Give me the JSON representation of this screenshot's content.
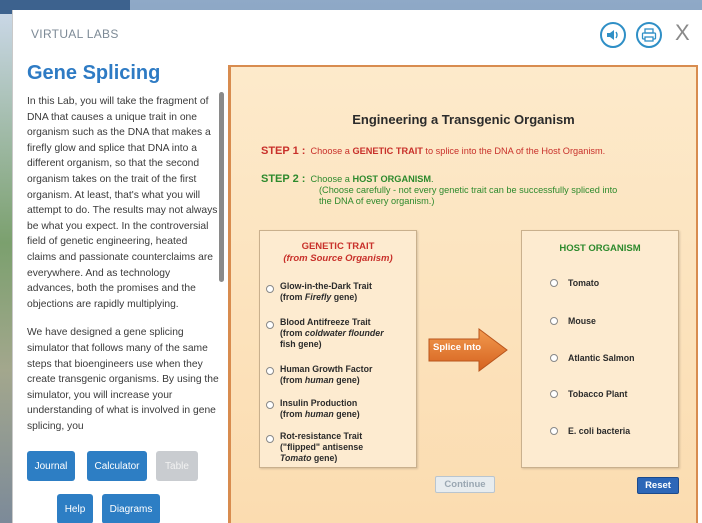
{
  "window": {
    "app_title": "VIRTUAL LABS",
    "close_glyph": "X"
  },
  "toolbar": {
    "icons": [
      "audio-icon",
      "print-icon",
      "close-icon"
    ]
  },
  "lesson": {
    "title": "Gene Splicing",
    "paragraphs": [
      "In this Lab, you will take the fragment of DNA that causes a unique trait in one organism such as the DNA that makes a firefly glow and splice that DNA into a different organism, so that the second organism takes on the trait of the first organism. At least, that's what you will attempt to do. The results may not always be what you expect. In the controversial field of genetic engineering, heated claims and passionate counterclaims are everywhere. And as technology advances, both the promises and the objections are rapidly multiplying.",
      "We have designed a gene splicing simulator that follows many of the same steps that bioengineers use when they create transgenic organisms. By using the simulator, you will increase your understanding of what is involved in gene splicing, you"
    ]
  },
  "tools": {
    "journal": "Journal",
    "calculator": "Calculator",
    "table": "Table",
    "help": "Help",
    "diagrams": "Diagrams"
  },
  "simulator": {
    "title": "Engineering a Transgenic Organism",
    "step1": {
      "label": "STEP 1 :",
      "pre": "Choose a ",
      "key": "GENETIC TRAIT",
      "post": " to splice into the DNA of the Host Organism."
    },
    "step2": {
      "label": "STEP 2 :",
      "pre": "Choose a ",
      "key": "HOST ORGANISM",
      "post": ".",
      "note_line1": "(Choose carefully - not every genetic trait can be successfully spliced into",
      "note_line2": "the DNA of every organism.)"
    },
    "genetic_panel": {
      "title": "GENETIC TRAIT",
      "subtitle": "(from Source Organism)",
      "options": [
        {
          "line1": "Glow-in-the-Dark Trait",
          "line2_pre": "(from ",
          "line2_em": "Firefly",
          "line2_post": " gene)",
          "line3": ""
        },
        {
          "line1": "Blood Antifreeze Trait",
          "line2_pre": "(from ",
          "line2_em": "coldwater flounder",
          "line2_post": "",
          "line3": "fish gene)"
        },
        {
          "line1": "Human Growth Factor",
          "line2_pre": "(from ",
          "line2_em": "human",
          "line2_post": " gene)",
          "line3": ""
        },
        {
          "line1": "Insulin Production",
          "line2_pre": "(from ",
          "line2_em": "human",
          "line2_post": " gene)",
          "line3": ""
        },
        {
          "line1": "Rot-resistance Trait",
          "line2_pre": "(\"flipped\" antisense",
          "line2_em": "",
          "line2_post": "",
          "line3_em": "Tomato",
          "line3": " gene)"
        }
      ]
    },
    "host_panel": {
      "title": "HOST ORGANISM",
      "options": [
        "Tomato",
        "Mouse",
        "Atlantic Salmon",
        "Tobacco Plant",
        "E. coli bacteria"
      ]
    },
    "splice_button": "Splice Into",
    "continue_button": "Continue",
    "reset_button": "Reset"
  },
  "colors": {
    "accent_blue": "#2d7ec4",
    "step1_red": "#c8302a",
    "step2_green": "#2d8a2d",
    "arrow_orange": "#e0762e",
    "sim_bg": "#fbdcb0"
  }
}
